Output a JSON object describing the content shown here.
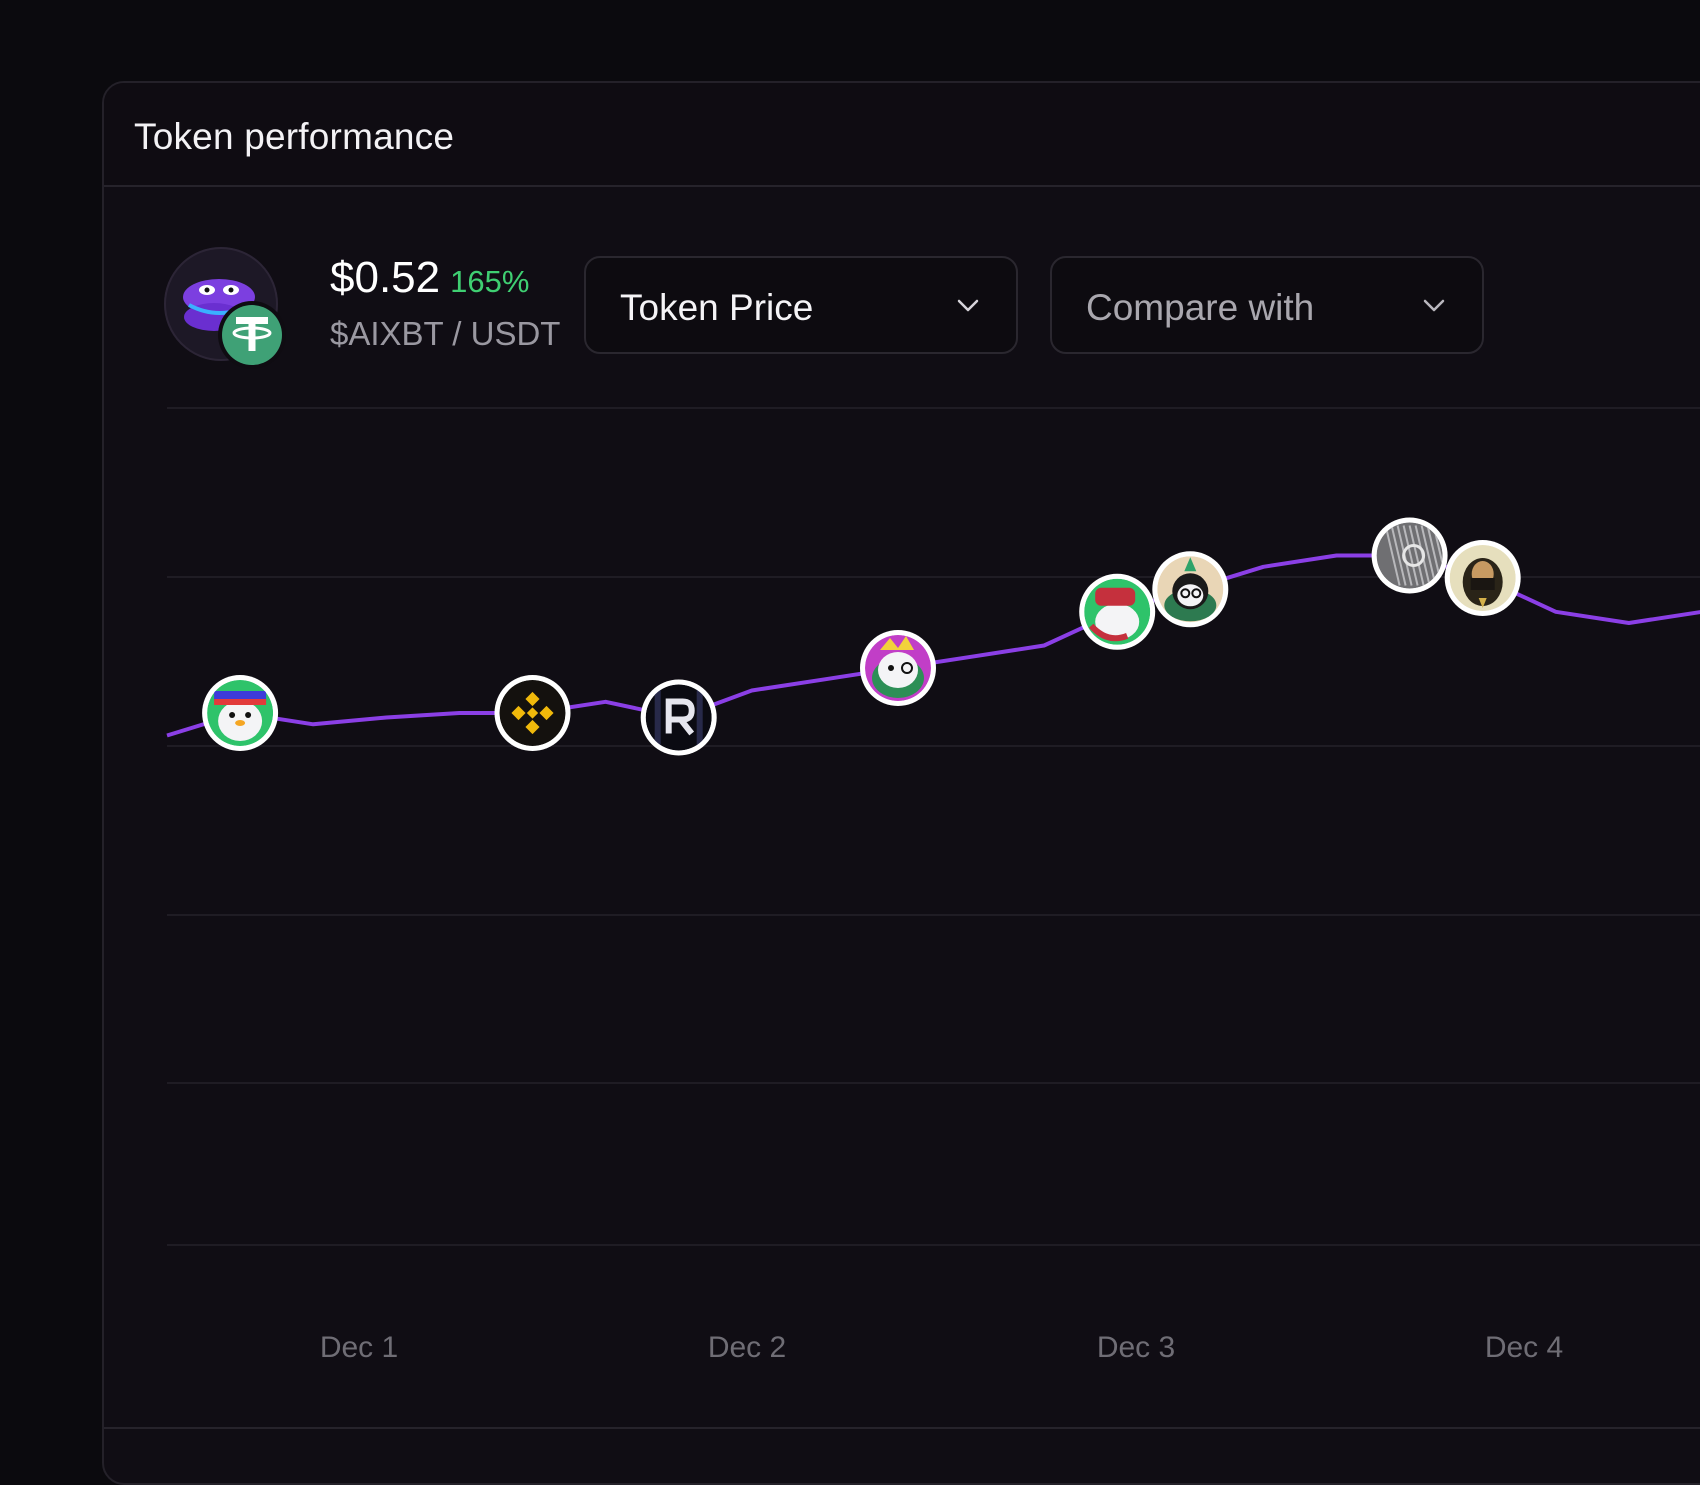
{
  "panel": {
    "title": "Token performance"
  },
  "token": {
    "price": "$0.52",
    "change": "165%",
    "pair": "$AIXBT / USDT",
    "avatar_icon": "aixbt-token-icon",
    "quote_icon": "usdt-tether-icon",
    "change_color": "#3fcf72"
  },
  "controls": {
    "metric_dropdown": {
      "selected": "Token Price",
      "icon": "chevron-down-icon"
    },
    "compare_dropdown": {
      "placeholder": "Compare with",
      "icon": "chevron-down-icon"
    }
  },
  "chart_data": {
    "type": "line",
    "line_color": "#8b3fe6",
    "grid": true,
    "x_ticks": [
      "Dec 1",
      "Dec 2",
      "Dec 3",
      "Dec 4"
    ],
    "series": [
      {
        "values": [
          0.47,
          0.48,
          0.475,
          0.478,
          0.48,
          0.48,
          0.485,
          0.478,
          0.49,
          0.495,
          0.5,
          0.505,
          0.51,
          0.525,
          0.535,
          0.545,
          0.55,
          0.55,
          0.54,
          0.525,
          0.52,
          0.525
        ]
      }
    ],
    "markers": [
      {
        "name": "penguin-avatar-marker",
        "index": 1
      },
      {
        "name": "binance-logo-marker",
        "index": 5
      },
      {
        "name": "r-logo-marker",
        "index": 7
      },
      {
        "name": "penguin-mohawk-avatar-marker",
        "index": 10
      },
      {
        "name": "penguin-cap-avatar-marker",
        "index": 13
      },
      {
        "name": "penguin-glasses-avatar-marker",
        "index": 14
      },
      {
        "name": "sculpture-avatar-marker",
        "index": 17
      },
      {
        "name": "masked-avatar-marker",
        "index": 18
      }
    ]
  }
}
